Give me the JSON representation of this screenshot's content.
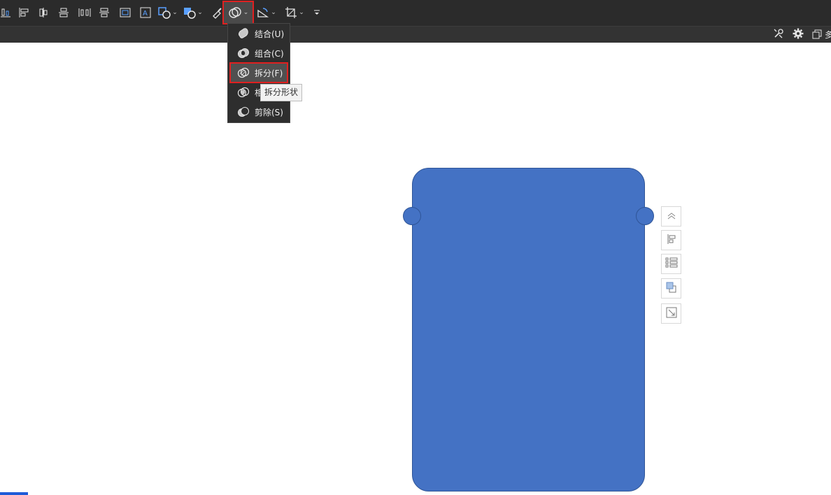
{
  "toolbar": {
    "items": [
      {
        "name": "distribute-bottom-icon"
      },
      {
        "name": "align-left-icon"
      },
      {
        "name": "align-center-horizontal-icon"
      },
      {
        "name": "align-top-icon"
      },
      {
        "name": "distribute-horizontal-icon"
      },
      {
        "name": "align-middle-vertical-icon"
      },
      {
        "name": "select-pane-icon"
      },
      {
        "name": "textbox-icon"
      },
      {
        "name": "shape-fill-icon"
      },
      {
        "name": "shape-outline-icon"
      },
      {
        "name": "format-painter-icon"
      },
      {
        "name": "merge-shapes-icon"
      },
      {
        "name": "rotate-icon"
      },
      {
        "name": "crop-icon"
      },
      {
        "name": "more-icon"
      }
    ]
  },
  "subbar": {
    "right_label": "多"
  },
  "merge_menu": {
    "items": [
      {
        "label": "结合(U)",
        "icon": "union-icon"
      },
      {
        "label": "组合(C)",
        "icon": "combine-icon"
      },
      {
        "label": "拆分(F)",
        "icon": "fragment-icon",
        "highlighted": true
      },
      {
        "label": "相交(I)",
        "icon": "intersect-icon"
      },
      {
        "label": "剪除(S)",
        "icon": "subtract-icon"
      }
    ],
    "tooltip": "拆分形状"
  },
  "colors": {
    "shape_fill": "#4472c4",
    "shape_border": "#2f5597",
    "highlight_border": "#e02020",
    "toolbar_bg": "#2b2b2b"
  }
}
